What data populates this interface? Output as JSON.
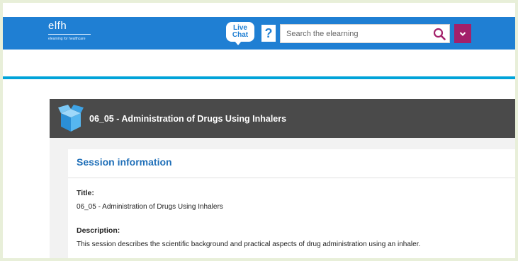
{
  "header": {
    "logo_main": "elfh",
    "logo_sub": "elearning for healthcare",
    "live_chat_line1": "Live",
    "live_chat_line2": "Chat",
    "help_label": "?",
    "search_placeholder": "Search the elearning",
    "brand_color": "#1f7fd3",
    "dropdown_color": "#a3206a"
  },
  "course": {
    "title": "06_05 - Administration of Drugs Using Inhalers"
  },
  "session": {
    "heading": "Session information",
    "title_label": "Title:",
    "title_value": "06_05 - Administration of Drugs Using Inhalers",
    "description_label": "Description:",
    "description_value": "This session describes the scientific background and practical aspects of drug administration using an inhaler."
  }
}
